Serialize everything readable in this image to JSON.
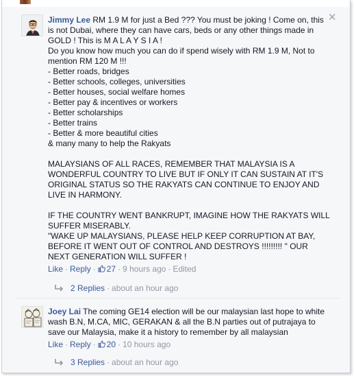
{
  "comments": [
    {
      "author": "Jimmy Lee",
      "text": "RM 1.9 M for just a Bed ??? You must be joking ! Come on, this is not Dubai, where they can have cars, beds or any other things made in GOLD ! This is M A L A Y S I A !\nDo you know how much you can do if spend wisely with RM 1.9 M, Not to mention RM 120 M !!!\n- Better roads, bridges\n- Better schools, colleges, universities\n- Better houses, social welfare homes\n- Better pay & incentives or workers\n- Better scholarships\n- Better trains\n- Better & more beautiful cities\n& many many to help the Rakyats\n\nMALAYSIANS OF ALL RACES, REMEMBER THAT MALAYSIA IS A WONDERFUL COUNTRY TO LIVE BUT IF ONLY IT CAN SUSTAIN AT IT'S ORIGINAL STATUS SO THE RAKYATS CAN CONTINUE TO ENJOY AND LIVE IN HARMONY.\n\nIF THE COUNTRY WENT BANKRUPT, IMAGINE HOW THE RAKYATS WILL SUFFER MISERABLY.\n\"WAKE UP MALAYSIANS, PLEASE HELP KEEP CORRUPTION AT BAY, BEFORE IT WENT OUT OF CONTROL AND DESTROYS !!!!!!!!! \" OUR NEXT GENERATION WILL SUFFER !",
      "like_label": "Like",
      "reply_label": "Reply",
      "like_count": "27",
      "time": "9 hours ago",
      "edited": "Edited",
      "replies_label": "2 Replies",
      "replies_time": "about an hour ago",
      "close_glyph": "✕"
    },
    {
      "author": "Joey Lai",
      "text": "The coming GE14 election will be our malaysian last hope to white wash B.N, M.CA, MIC, GERAKAN & all the B.N parties out of putrajaya to save our Malaysia, make it a history to remember by all malaysian",
      "like_label": "Like",
      "reply_label": "Reply",
      "like_count": "20",
      "time": "10 hours ago",
      "replies_label": "3 Replies",
      "replies_time": "about an hour ago"
    }
  ],
  "separator": "·",
  "colors": {
    "link": "#3b5998",
    "muted": "#9197a3",
    "background": "#f6f7f9"
  }
}
